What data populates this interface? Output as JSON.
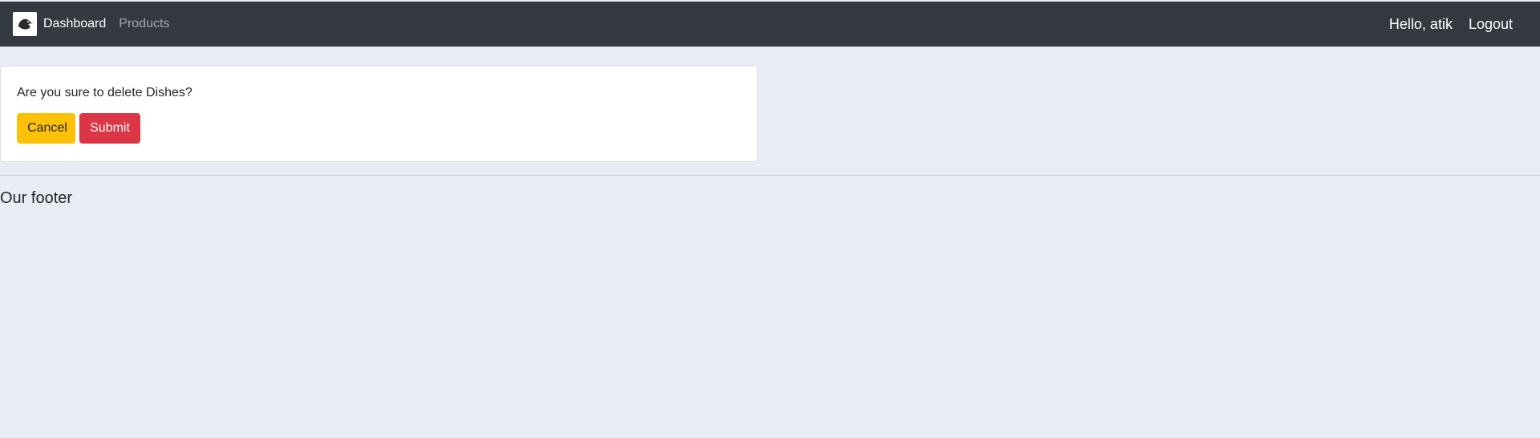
{
  "navbar": {
    "logo_icon": "bird-logo-icon",
    "brand_label": "Dashboard",
    "products_label": "Products",
    "greeting": "Hello, atik",
    "logout_label": "Logout",
    "background": "#343a40"
  },
  "dialog": {
    "question": "Are you sure to delete Dishes?",
    "cancel_label": "Cancel",
    "submit_label": "Submit",
    "cancel_color": "#ffc107",
    "submit_color": "#dc3545"
  },
  "footer": {
    "text": "Our footer"
  },
  "colors": {
    "page_background": "#e9ecf4"
  }
}
